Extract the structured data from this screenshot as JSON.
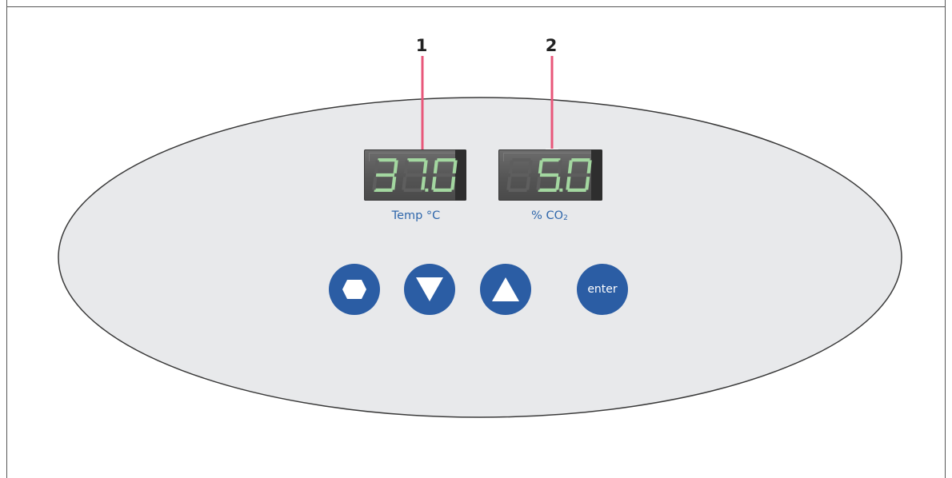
{
  "callouts": [
    "1",
    "2"
  ],
  "displays": [
    {
      "id": "temperature",
      "value": "37.0",
      "label": "Temp °C"
    },
    {
      "id": "co2",
      "value": "5.0",
      "label_prefix": "% CO",
      "label_sub": "2"
    }
  ],
  "buttons": [
    {
      "id": "menu",
      "icon": "hexagon-icon"
    },
    {
      "id": "down",
      "icon": "triangle-down-icon"
    },
    {
      "id": "up",
      "icon": "triangle-up-icon"
    },
    {
      "id": "enter",
      "label": "enter"
    }
  ],
  "colors": {
    "panel_fill": "#e8e9eb",
    "panel_stroke": "#3a3a3a",
    "button": "#2b5da4",
    "label_text": "#2f67ab",
    "callout_marker": "#e8577a",
    "segment_lit": "#a3d7a0"
  }
}
